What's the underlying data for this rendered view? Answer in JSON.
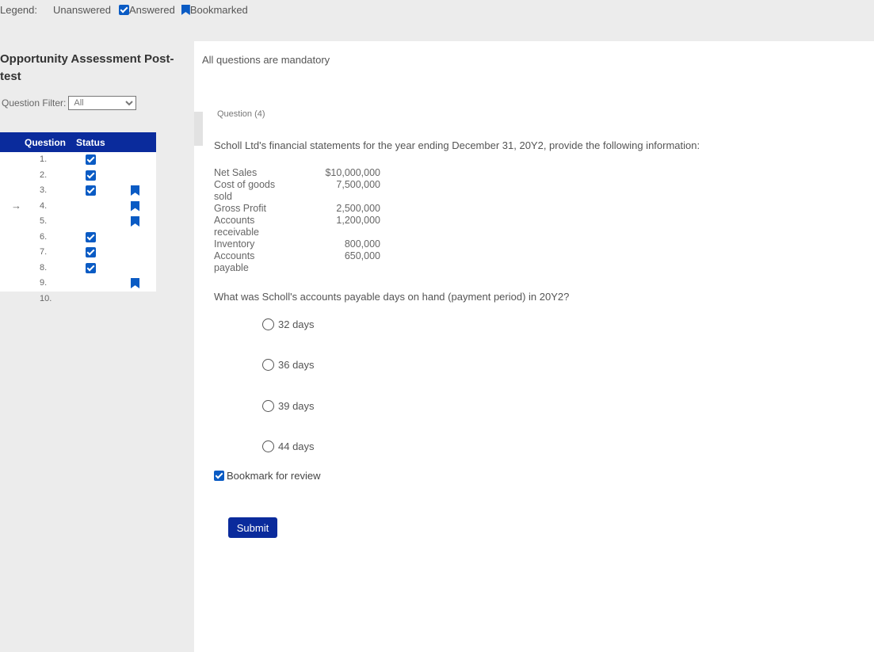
{
  "legend": {
    "label": "Legend:",
    "unanswered": "Unanswered",
    "answered": "Answered",
    "bookmarked": "Bookmarked"
  },
  "sidebar": {
    "title_line1": "Opportunity Assessment Post-",
    "title_line2": "test",
    "filter_label": "Question Filter:",
    "filter_value": "All",
    "table_headers": [
      "Question",
      "Status"
    ],
    "questions": [
      {
        "num": "1.",
        "answered": true,
        "bookmarked": false,
        "current": false
      },
      {
        "num": "2.",
        "answered": true,
        "bookmarked": false,
        "current": false
      },
      {
        "num": "3.",
        "answered": true,
        "bookmarked": true,
        "current": false
      },
      {
        "num": "4.",
        "answered": false,
        "bookmarked": true,
        "current": true
      },
      {
        "num": "5.",
        "answered": false,
        "bookmarked": true,
        "current": false
      },
      {
        "num": "6.",
        "answered": true,
        "bookmarked": false,
        "current": false
      },
      {
        "num": "7.",
        "answered": true,
        "bookmarked": false,
        "current": false
      },
      {
        "num": "8.",
        "answered": true,
        "bookmarked": false,
        "current": false
      },
      {
        "num": "9.",
        "answered": false,
        "bookmarked": true,
        "current": false
      },
      {
        "num": "10.",
        "answered": false,
        "bookmarked": false,
        "current": false
      }
    ],
    "current_arrow": "→"
  },
  "main": {
    "mandatory": "All questions are mandatory",
    "question_label": "Question (4)",
    "question_text": "Scholl Ltd's financial statements for the year ending December 31, 20Y2, provide the following information:",
    "financials": [
      {
        "label": [
          "Net Sales"
        ],
        "value": "$10,000,000"
      },
      {
        "label": [
          "Cost of goods",
          "sold"
        ],
        "value": "7,500,000"
      },
      {
        "label": [
          "Gross Profit"
        ],
        "value": "2,500,000"
      },
      {
        "label": [
          "Accounts",
          "receivable"
        ],
        "value": "1,200,000"
      },
      {
        "label": [
          "Inventory"
        ],
        "value": "800,000"
      },
      {
        "label": [
          "Accounts",
          "payable"
        ],
        "value": "650,000"
      }
    ],
    "prompt": "What was Scholl's accounts payable days on hand (payment period) in 20Y2?",
    "options": [
      "32 days",
      "36 days",
      "39 days",
      "44 days"
    ],
    "bookmark_label": "Bookmark for review",
    "bookmark_checked": true,
    "submit_label": "Submit"
  },
  "colors": {
    "accent": "#0a2b9c",
    "check": "#0a5bc4",
    "sidebar_bg": "#ececec"
  }
}
